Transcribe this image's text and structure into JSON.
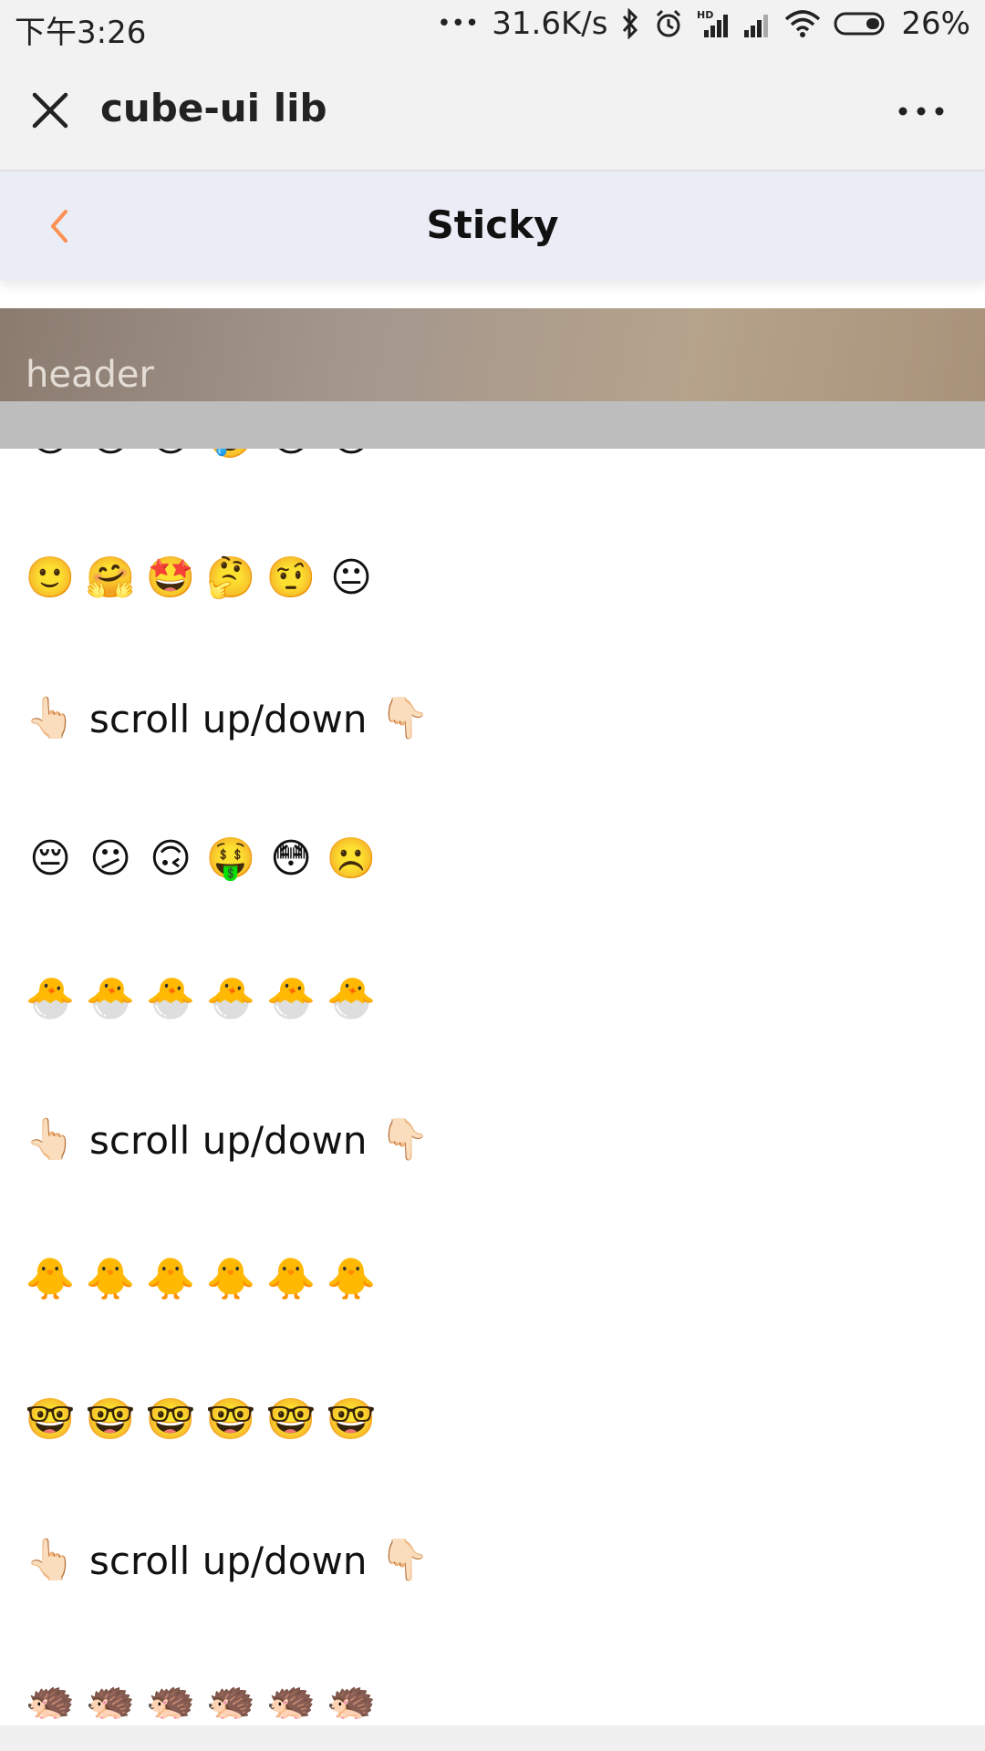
{
  "status_bar": {
    "time": "下午3:26",
    "dots": "•••",
    "network_speed": "31.6K/s",
    "battery": "26%",
    "icons": [
      "bluetooth-icon",
      "alarm-icon",
      "hd-signal-icon",
      "signal-icon",
      "wifi-icon",
      "battery-icon"
    ]
  },
  "app_bar": {
    "title": "cube-ui lib",
    "close_icon": "close-icon",
    "more_icon": "more-icon"
  },
  "nav_bar": {
    "title": "Sticky",
    "back_icon": "chevron-left-icon",
    "accent_color": "#fc9153"
  },
  "header": {
    "label": "header"
  },
  "rows": [
    {
      "type": "emoji",
      "items": [
        "😀",
        "😁",
        "😂",
        "🤣",
        "😃",
        "😄"
      ]
    },
    {
      "type": "emoji",
      "items": [
        "🙂",
        "🤗",
        "🤩",
        "🤔",
        "🤨",
        "😐"
      ]
    },
    {
      "type": "text",
      "left": "👆🏻",
      "text": "scroll up/down",
      "right": "👇🏻"
    },
    {
      "type": "emoji",
      "items": [
        "😔",
        "😕",
        "🙃",
        "🤑",
        "😳",
        "☹️"
      ]
    },
    {
      "type": "emoji",
      "items": [
        "🐣",
        "🐣",
        "🐣",
        "🐣",
        "🐣",
        "🐣"
      ]
    },
    {
      "type": "text",
      "left": "👆🏻",
      "text": "scroll up/down",
      "right": "👇🏻"
    },
    {
      "type": "emoji",
      "items": [
        "🐥",
        "🐥",
        "🐥",
        "🐥",
        "🐥",
        "🐥"
      ]
    },
    {
      "type": "emoji",
      "items": [
        "🤓",
        "🤓",
        "🤓",
        "🤓",
        "🤓",
        "🤓"
      ]
    },
    {
      "type": "text",
      "left": "👆🏻",
      "text": "scroll up/down",
      "right": "👇🏻"
    },
    {
      "type": "emoji",
      "items": [
        "🦔",
        "🦔",
        "🦔",
        "🦔",
        "🦔",
        "🦔"
      ]
    }
  ]
}
